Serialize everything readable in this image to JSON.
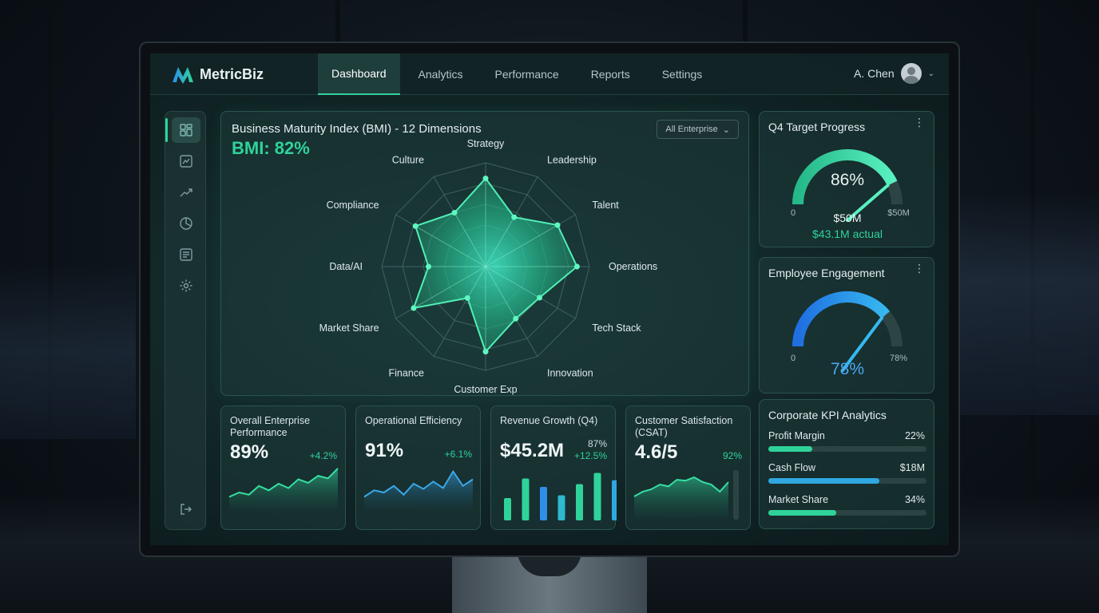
{
  "app": {
    "logo_text": "MetricBiz",
    "accent": "#2fd39a",
    "blue_accent": "#2f8fe8"
  },
  "nav": {
    "tabs": [
      {
        "label": "Dashboard",
        "active": true
      },
      {
        "label": "Analytics",
        "active": false
      },
      {
        "label": "Performance",
        "active": false
      },
      {
        "label": "Reports",
        "active": false
      },
      {
        "label": "Settings",
        "active": false
      }
    ]
  },
  "user": {
    "name": "A. Chen"
  },
  "sidebar": {
    "icons": [
      "dashboard-icon",
      "line-chart-icon",
      "trend-icon",
      "pie-chart-icon",
      "report-icon",
      "settings-icon"
    ],
    "bottom_icon": "logout-icon"
  },
  "bmi": {
    "title": "Business Maturity Index (BMI) - 12 Dimensions",
    "value": "BMI: 82%",
    "filter": "All Enterprise"
  },
  "chart_data": {
    "type": "radar",
    "categories": [
      "Strategy",
      "Leadership",
      "Talent",
      "Operations",
      "Tech Stack",
      "Innovation",
      "Customer Exp",
      "Finance",
      "Market Share",
      "Data/AI",
      "Compliance",
      "Culture"
    ],
    "values": [
      85,
      55,
      80,
      88,
      60,
      58,
      82,
      35,
      80,
      55,
      78,
      60
    ],
    "ylim": [
      0,
      100
    ]
  },
  "q4_target": {
    "title": "Q4 Target Progress",
    "percent_text": "86%",
    "percent": 86,
    "min_label": "0",
    "max_label": "$50M",
    "target": "$50M",
    "actual": "$43.1M actual"
  },
  "engagement": {
    "title": "Employee Engagement",
    "percent_text": "78%",
    "percent": 78,
    "min_label": "0",
    "max_label": "78%"
  },
  "cards": [
    {
      "title": "Overall Enterprise Performance",
      "value": "89%",
      "delta": "+4.2%",
      "spark": [
        30,
        40,
        35,
        55,
        45,
        60,
        50,
        70,
        62,
        78,
        72,
        95
      ]
    },
    {
      "title": "Operational Efficiency",
      "value": "91%",
      "delta": "+6.1%",
      "spark": [
        30,
        45,
        40,
        55,
        35,
        60,
        48,
        65,
        50,
        88,
        55,
        70
      ]
    },
    {
      "title": "Revenue Growth (Q4)",
      "value": "$45.2M",
      "delta_top": "87%",
      "delta": "+12.5%",
      "bars": [
        40,
        75,
        60,
        45,
        65,
        85,
        72
      ]
    },
    {
      "title": "Customer Satisfaction (CSAT)",
      "value": "4.6/5",
      "delta": "92%",
      "spark": [
        45,
        55,
        60,
        70,
        66,
        80,
        78,
        85,
        75,
        70,
        55,
        75
      ]
    }
  ],
  "kpi": {
    "title": "Corporate KPI Analytics",
    "rows": [
      {
        "label": "Profit Margin",
        "value": "22%",
        "fill": 0.28,
        "color": "#2fd39a"
      },
      {
        "label": "Cash Flow",
        "value": "$18M",
        "fill": 0.7,
        "color": "#2fa8e0"
      },
      {
        "label": "Market Share",
        "value": "34%",
        "fill": 0.43,
        "color": "#2fd39a"
      }
    ]
  }
}
